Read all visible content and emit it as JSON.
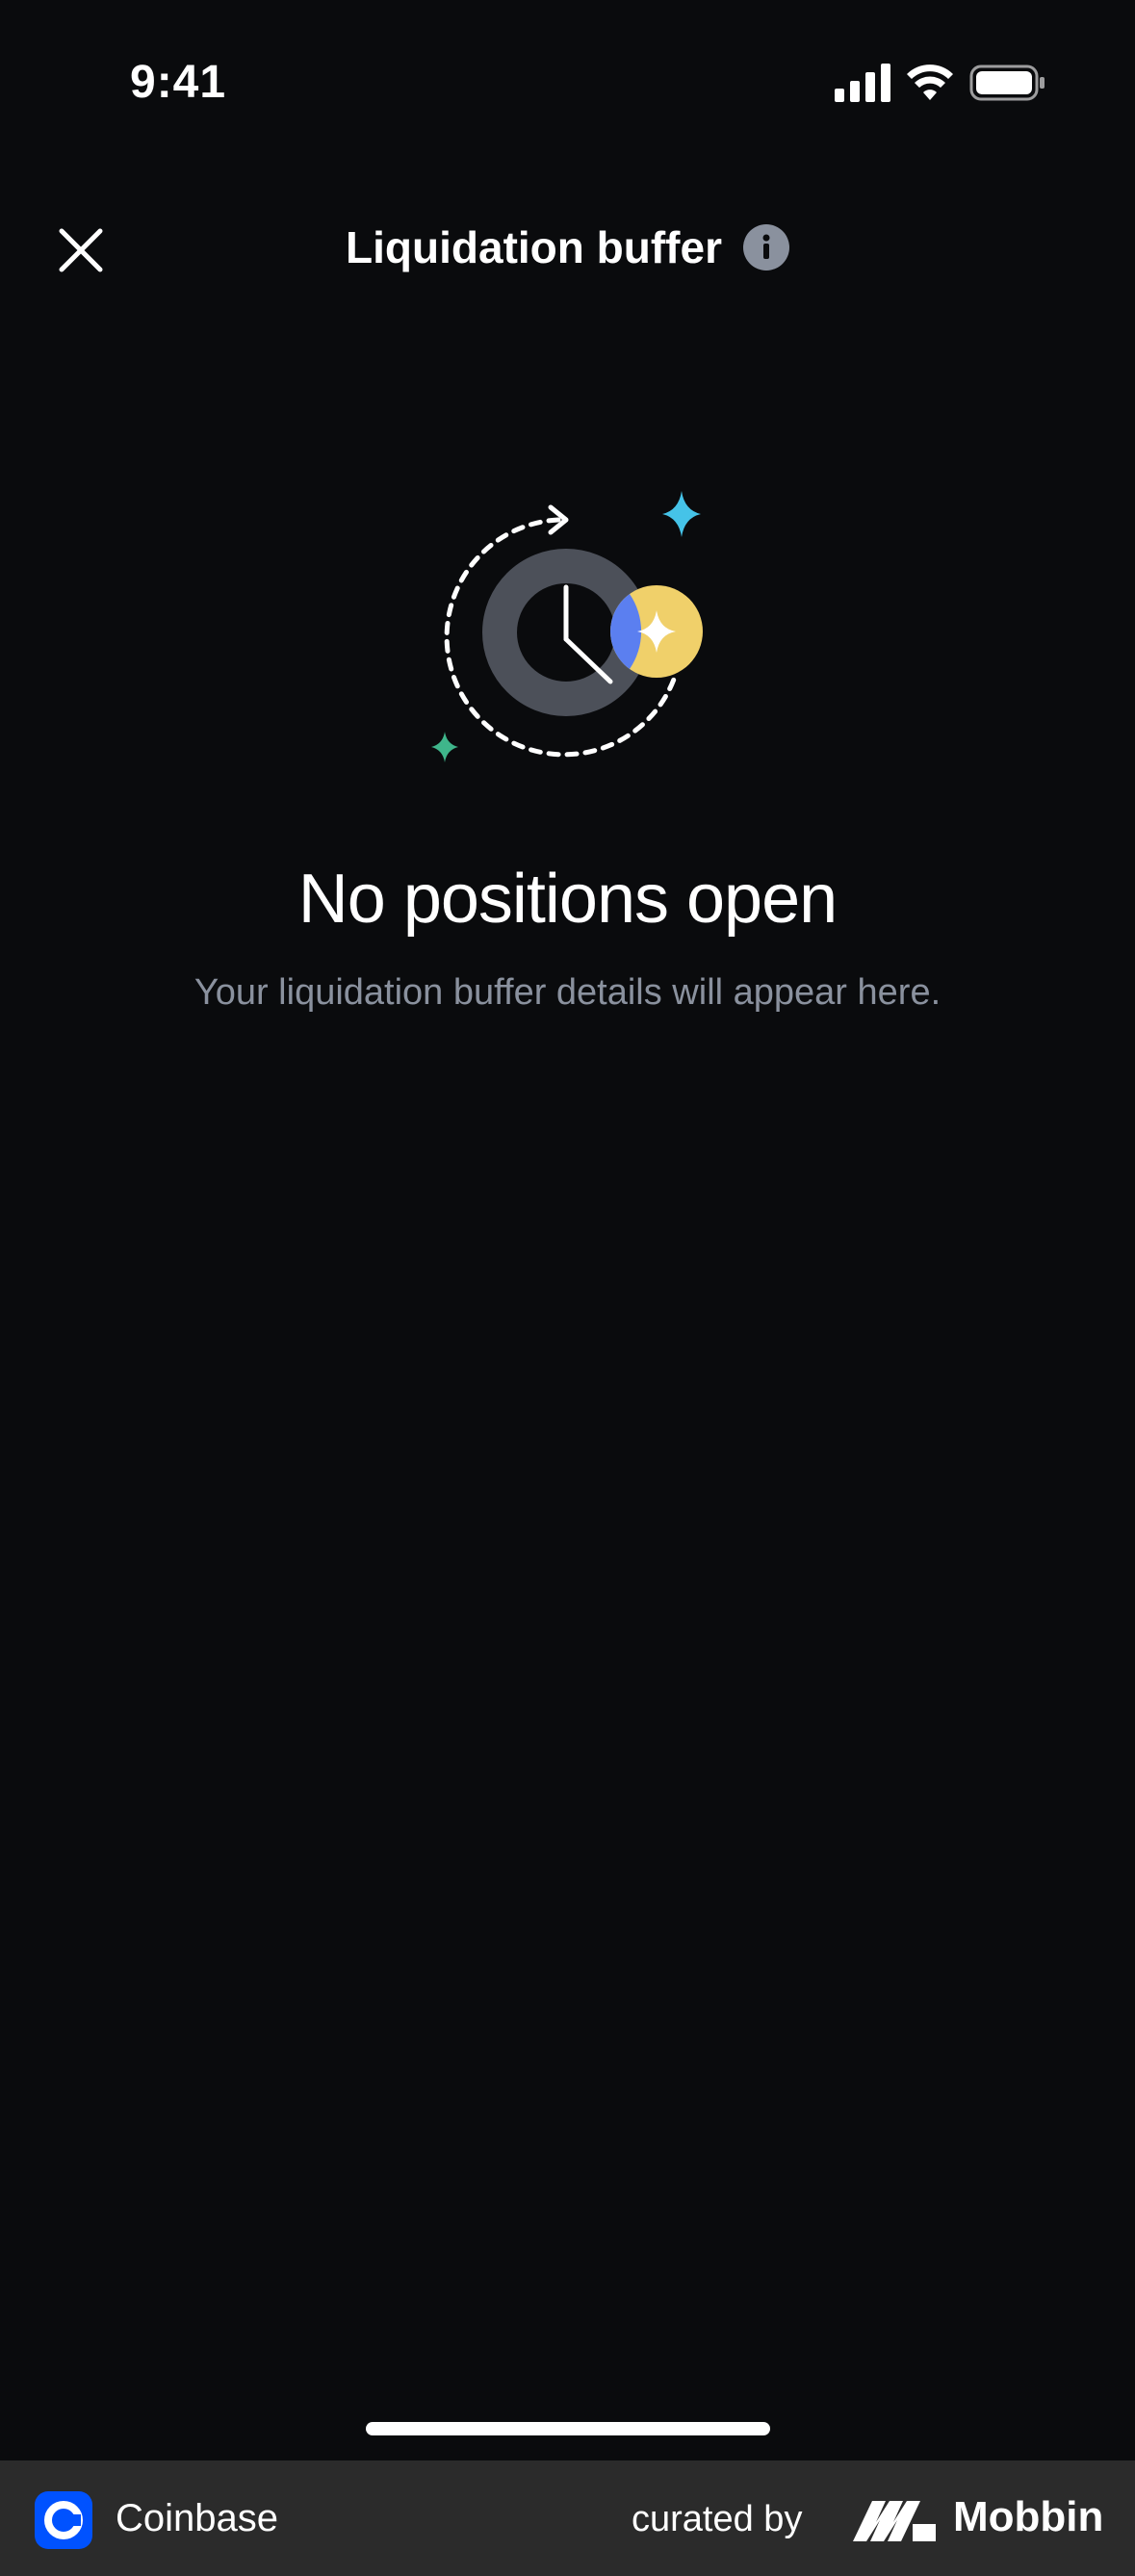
{
  "status_bar": {
    "time": "9:41"
  },
  "header": {
    "title": "Liquidation buffer"
  },
  "empty_state": {
    "title": "No positions open",
    "subtitle": "Your liquidation buffer details will appear here."
  },
  "footer": {
    "brand": "Coinbase",
    "curated_label": "curated by",
    "curator": "Mobbin"
  },
  "colors": {
    "background": "#0a0b0d",
    "muted_text": "#8a919e",
    "accent_blue": "#5b7ff0",
    "accent_yellow": "#f0d06a",
    "sparkle_cyan": "#45c3e8",
    "sparkle_green": "#3fb68b"
  }
}
